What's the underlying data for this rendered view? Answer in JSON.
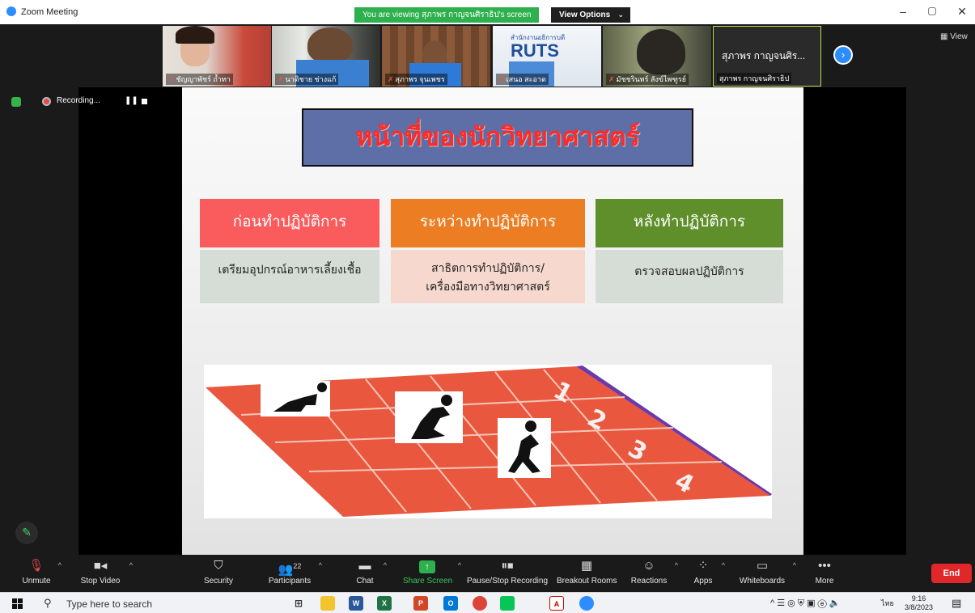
{
  "window": {
    "app_title": "Zoom Meeting",
    "viewing_banner": "You are viewing สุภาพร กาญจนศิราธิป's screen",
    "view_options": "View Options",
    "view_label": "View",
    "minimize": "–",
    "restore": "▢",
    "close": "✕"
  },
  "participants_strip": [
    {
      "name": "ชัญญาพัชร์ ถ้ำทา",
      "muted": true
    },
    {
      "name": "นาติชาย ช่างแก้",
      "muted": true
    },
    {
      "name": "สุภาพร จุนเพชร",
      "muted": true
    },
    {
      "name": "เสนอ สะอาด",
      "muted": true
    },
    {
      "name": "มัชชรินทร์ สังข์ไพฑูรย์",
      "muted": true
    },
    {
      "name": "สุภาพร กาญจนศิราธิป",
      "display": "สุภาพร กาญจนศิร...",
      "muted": false,
      "active": true
    }
  ],
  "thumb_org": {
    "line1": "สำนักงานอธิการบดี",
    "line2": "RUTS"
  },
  "recording": {
    "label": "Recording...",
    "pause": "❚❚"
  },
  "slide": {
    "title": "หน้าที่ของนักวิทยาศาสตร์",
    "columns": [
      {
        "header": "ก่อนทำปฏิบัติการ",
        "body": [
          "เตรียมอุปกรณ์อาหารเลี้ยงเชื้อ"
        ],
        "head_color": "#fa5c5e",
        "body_color": "#d6ddd6"
      },
      {
        "header": "ระหว่างทำปฏิบัติการ",
        "body": [
          "สาธิตการทำปฏิบัติการ/",
          "เครื่องมือทางวิทยาศาสตร์"
        ],
        "head_color": "#ec7d22",
        "body_color": "#f7d8ce"
      },
      {
        "header": "หลังทำปฏิบัติการ",
        "body": [
          "ตรวจสอบผลปฏิบัติการ"
        ],
        "head_color": "#5f8f2a",
        "body_color": "#d6ddd6"
      }
    ],
    "track_lanes": [
      "1",
      "2",
      "3",
      "4"
    ]
  },
  "toolbar": {
    "unmute": "Unmute",
    "stop_video": "Stop Video",
    "security": "Security",
    "participants": "Participants",
    "participants_count": "22",
    "chat": "Chat",
    "share_screen": "Share Screen",
    "pause_stop_recording": "Pause/Stop Recording",
    "breakout_rooms": "Breakout Rooms",
    "reactions": "Reactions",
    "apps": "Apps",
    "whiteboards": "Whiteboards",
    "more": "More",
    "end": "End"
  },
  "taskbar": {
    "search_placeholder": "Type here to search",
    "lang": "ไทย",
    "time": "9:16",
    "date": "3/8/2023"
  },
  "colors": {
    "zoom_blue": "#2d8cff",
    "share_green": "#2db04d",
    "end_red": "#e0272a"
  }
}
